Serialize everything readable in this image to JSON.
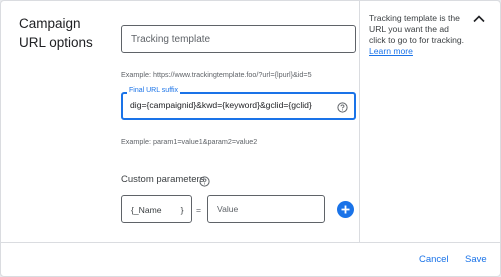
{
  "section": {
    "title": "Campaign URL options"
  },
  "help": {
    "text": "Tracking template is the URL you want the ad click to go to for tracking.",
    "link": "Learn more"
  },
  "tracking_template": {
    "placeholder": "Tracking template",
    "example": "Example: https://www.trackingtemplate.foo/?url={lpurl}&id=5"
  },
  "final_url_suffix": {
    "label": "Final URL suffix",
    "value": "dig={campaignid}&kwd={keyword}&gclid={gclid}",
    "example": "Example: param1=value1&param2=value2"
  },
  "custom_parameters": {
    "title": "Custom parameters",
    "name_placeholder": "{_Name        }",
    "equals": "=",
    "value_placeholder": "Value"
  },
  "footer": {
    "cancel": "Cancel",
    "save": "Save"
  },
  "colors": {
    "accent": "#1a73e8",
    "border": "#dadce0",
    "text": "#202124",
    "muted": "#5f6368"
  },
  "icons": {
    "collapse": "chevron-up-icon",
    "help": "help-circle-icon",
    "add": "plus-circle-icon"
  }
}
